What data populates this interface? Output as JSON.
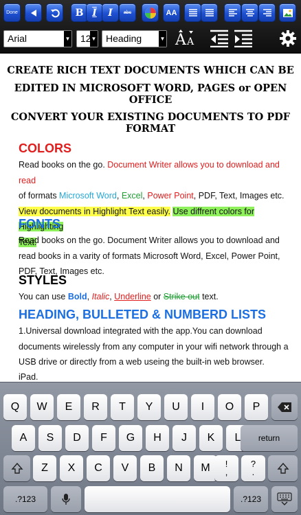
{
  "toolbar": {
    "done_label": "Done",
    "bold_label": "B",
    "italic_label": "I",
    "strike_label": "abc",
    "font_size_label": "AA",
    "font_family": "Arial",
    "font_size": "12",
    "style": "Heading",
    "accent_color": "#1d4fd0"
  },
  "document": {
    "banner_line1": "CREATE RICH TEXT DOCUMENTS WHICH CAN BE",
    "banner_line2": "EDITED IN MICROSOFT WORD, PAGES or OPEN OFFICE",
    "banner_line3": "CONVERT YOUR EXISTING DOCUMENTS TO PDF FORMAT",
    "colors_section": {
      "heading": "COLORS",
      "p1": "Read books on the go. ",
      "p2": "Document Writer allows you to download and read",
      "p3": "of formats ",
      "p4": "Microsoft Word",
      "p5": ", ",
      "p6": "Excel",
      "p7": ", ",
      "p8": "Power Point",
      "p9": ", PDF, Text, Images etc.",
      "hl1": "View documents in Highlight Text easily.",
      "hl2": "Use diffrent colors for Highlighting",
      "hl3": "Text."
    },
    "fonts_section": {
      "heading": "FONTS",
      "body": "Read books on the go. Document Writer allows you to download and read books in a varity of formats Microsoft Word, Excel, Power Point, PDF, Text, Images etc."
    },
    "styles_section": {
      "heading": "STYLES",
      "s1": "You can use ",
      "bold": "Bold",
      "s2": ", ",
      "italic": "Italic",
      "s3": ", ",
      "underline": "Underline",
      "s4": " or ",
      "strike": "Strike out",
      "s5": " text."
    },
    "lists_section": {
      "heading": "HEADING, BULLETED & NUMBERD LISTS",
      "item1": "1.Universal download integrated with the app.You can download documents wirelessly from any computer in your wifi network through a USB drive or directly from a web useing the built-in web browser.",
      "item2": "iPad."
    },
    "colors": {
      "red": "#e01d1d",
      "blue": "#1c6fe0",
      "cyan": "#25a8d6",
      "green": "#1f9e34",
      "yellow_hl": "#ffff4a",
      "green_hl": "#8ef05a"
    }
  },
  "keyboard": {
    "row1": [
      "Q",
      "W",
      "E",
      "R",
      "T",
      "Y",
      "U",
      "I",
      "O",
      "P"
    ],
    "row2": [
      "A",
      "S",
      "D",
      "F",
      "G",
      "H",
      "J",
      "K",
      "L"
    ],
    "row3": [
      "Z",
      "X",
      "C",
      "V",
      "B",
      "N",
      "M"
    ],
    "return_label": "return",
    "num_label": ".?123",
    "punct1_top": "!",
    "punct1_bottom": ",",
    "punct2_top": "?",
    "punct2_bottom": "."
  }
}
